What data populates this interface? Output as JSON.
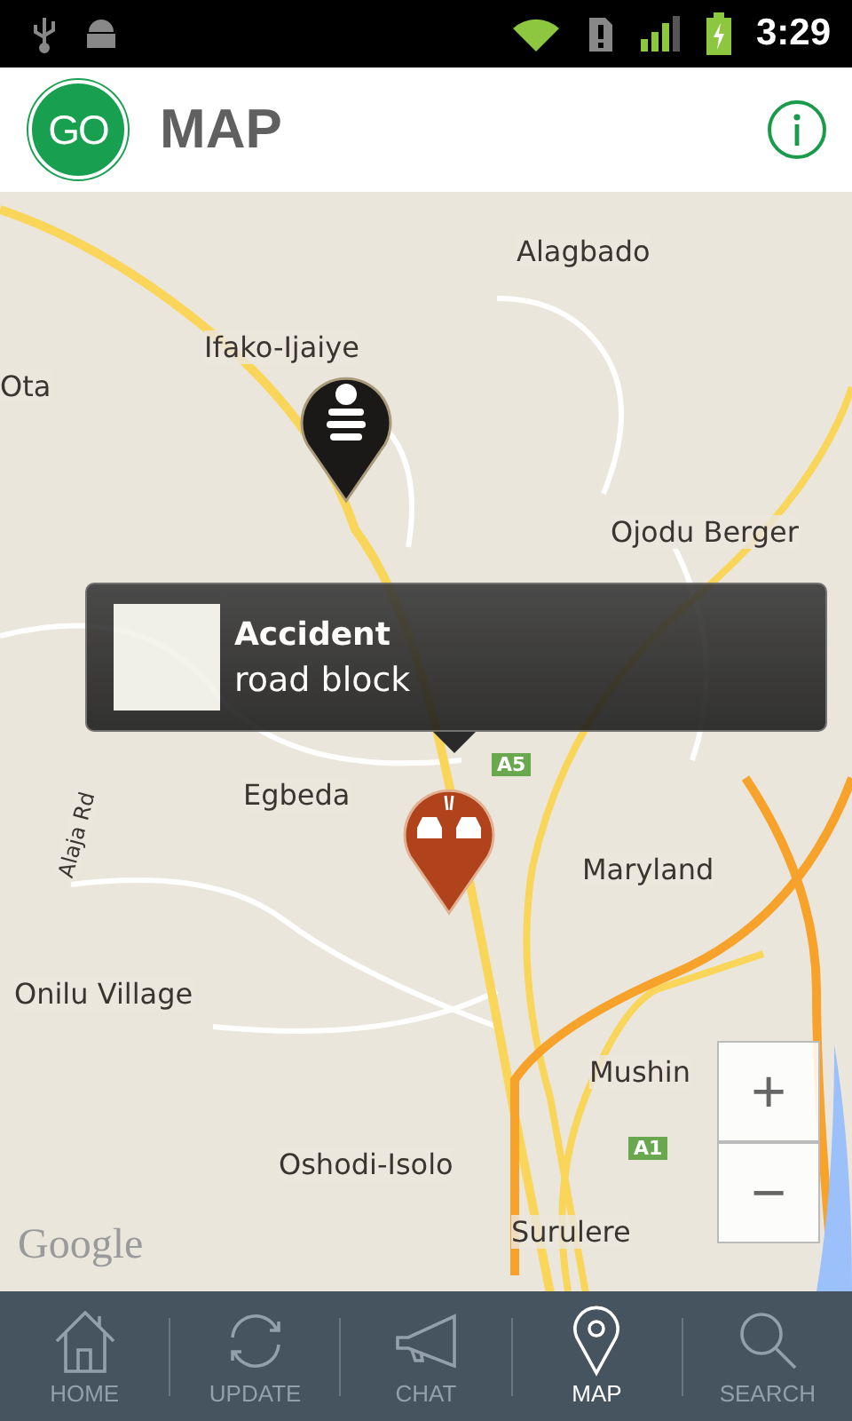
{
  "status_bar": {
    "time": "3:29"
  },
  "header": {
    "logo": "GO",
    "title": "MAP"
  },
  "map": {
    "labels": [
      {
        "text": "Alagbado"
      },
      {
        "text": "Ifako-Ijaiye"
      },
      {
        "text": "Ota"
      },
      {
        "text": "Ojodu Berger"
      },
      {
        "text": "Egbeda"
      },
      {
        "text": "Maryland"
      },
      {
        "text": "Alaja Rd"
      },
      {
        "text": "Onilu Village"
      },
      {
        "text": "Mushin"
      },
      {
        "text": "Oshodi-Isolo"
      },
      {
        "text": "Surulere"
      }
    ],
    "road_badges": [
      {
        "text": "A5"
      },
      {
        "text": "A1"
      }
    ],
    "attribution": "Google",
    "markers": [
      {
        "kind": "thief"
      },
      {
        "kind": "accident"
      }
    ],
    "popup": {
      "title": "Accident",
      "subtitle": "road block"
    },
    "zoom": {
      "plus": "+",
      "minus": "−"
    }
  },
  "nav": [
    {
      "kind": "home",
      "label": "HOME",
      "selected": false
    },
    {
      "kind": "update",
      "label": "UPDATE",
      "selected": false
    },
    {
      "kind": "chat",
      "label": "CHAT",
      "selected": false
    },
    {
      "kind": "map",
      "label": "MAP",
      "selected": true
    },
    {
      "kind": "search",
      "label": "SEARCH",
      "selected": false
    }
  ]
}
